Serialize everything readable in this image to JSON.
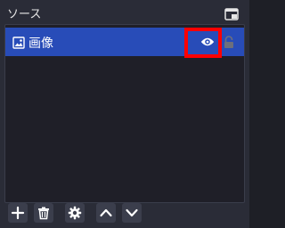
{
  "dock": {
    "title": "ソース",
    "float_icon": "float-window-icon"
  },
  "sources": [
    {
      "name": "画像",
      "type_icon": "image-icon",
      "visible": true,
      "visibility_icon": "eye-icon",
      "locked": false,
      "lock_icon": "lock-icon"
    }
  ],
  "toolbar": {
    "buttons": [
      {
        "icon": "plus-icon"
      },
      {
        "icon": "trash-icon"
      },
      {
        "icon": "gear-icon"
      },
      {
        "icon": "chevron-up-icon"
      },
      {
        "icon": "chevron-down-icon"
      }
    ]
  },
  "colors": {
    "background": "#2a2c37",
    "list_background": "#1f1f28",
    "selected_row": "#284cb8",
    "highlight": "#ff0000"
  }
}
